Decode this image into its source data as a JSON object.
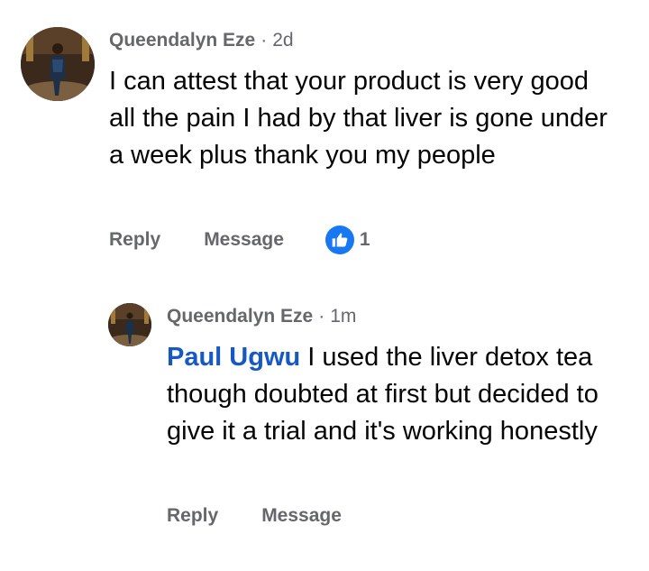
{
  "comments": [
    {
      "author": "Queendalyn Eze",
      "separator": "·",
      "time": "2d",
      "text": "I can attest that your product is very good all the pain I had by that liver is gone under a week plus thank you my people",
      "actions": {
        "reply": "Reply",
        "message": "Message"
      },
      "reaction": {
        "icon": "thumbs-up-icon",
        "count": "1"
      }
    }
  ],
  "replies": [
    {
      "author": "Queendalyn Eze",
      "separator": "·",
      "time": "1m",
      "mention": "Paul Ugwu",
      "text": " I used the liver detox tea though doubted at first but decided to give it a trial and it's working honestly",
      "actions": {
        "reply": "Reply",
        "message": "Message"
      }
    }
  ],
  "colors": {
    "meta_gray": "#65676b",
    "text": "#050505",
    "mention_blue": "#1659c2",
    "like_blue": "#1877f2"
  }
}
